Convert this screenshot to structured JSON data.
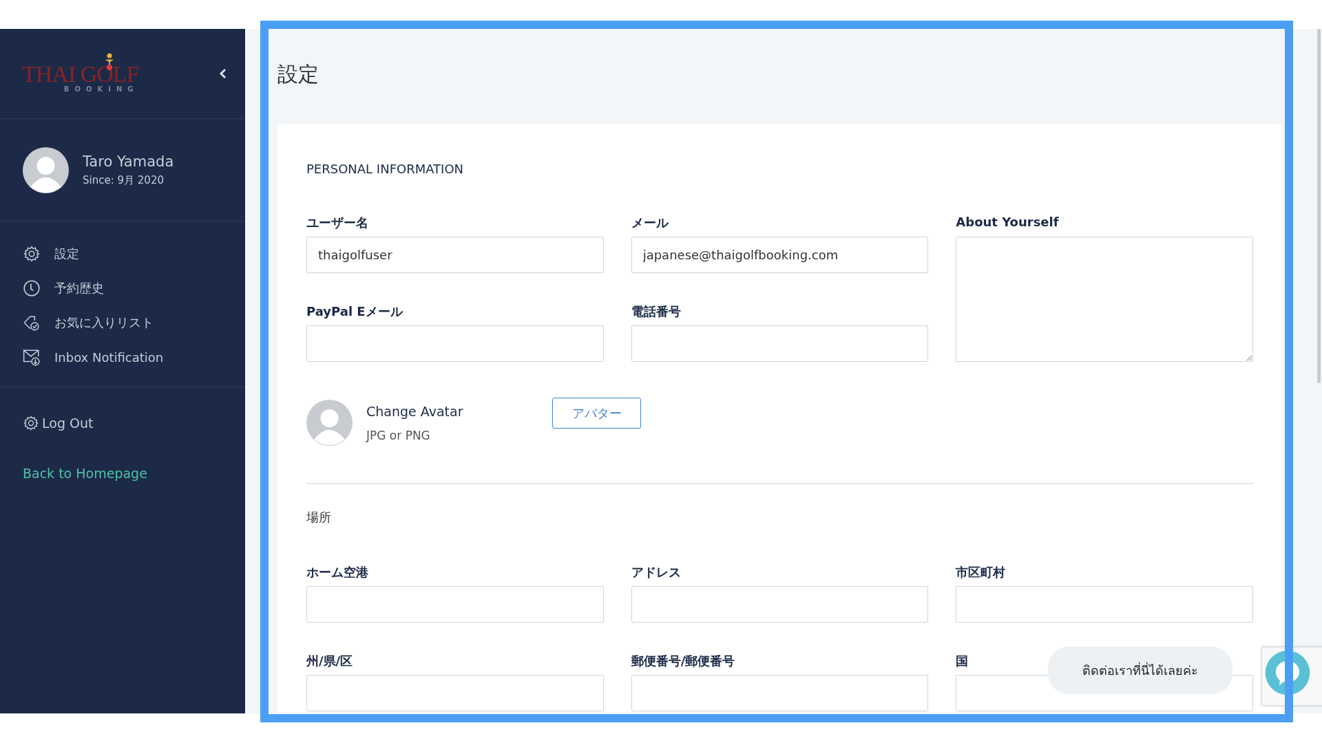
{
  "sidebar": {
    "logo": {
      "title": "THAI GOLF",
      "subtitle": "BOOKING"
    },
    "user": {
      "name": "Taro Yamada",
      "since": "Since: 9月 2020"
    },
    "menu": [
      {
        "label": "設定",
        "kind": "gear"
      },
      {
        "label": "予約歴史",
        "kind": "clock"
      },
      {
        "label": "お気に入りリスト",
        "kind": "tag"
      },
      {
        "label": "Inbox Notification",
        "kind": "mail"
      }
    ],
    "logout": "Log Out",
    "back_link": "Back to Homepage"
  },
  "page_title": "設定",
  "personal": {
    "heading": "PERSONAL INFORMATION",
    "fields": [
      {
        "label": "ユーザー名",
        "kind": "input",
        "value": "thaigolfuser"
      },
      {
        "label": "メール",
        "kind": "input",
        "value": "japanese@thaigolfbooking.com"
      },
      {
        "label": "About Yourself",
        "kind": "textarea"
      },
      {
        "label": "PayPal Eメール",
        "kind": "input"
      },
      {
        "label": "電話番号",
        "kind": "input"
      }
    ],
    "avatar": {
      "title": "Change Avatar",
      "hint": "JPG or PNG",
      "button": "アバター"
    }
  },
  "location": {
    "heading": "場所",
    "fields": [
      {
        "label": "ホーム空港",
        "kind": "input"
      },
      {
        "label": "アドレス",
        "kind": "input"
      },
      {
        "label": "市区町村",
        "kind": "input"
      },
      {
        "label": "州/県/区",
        "kind": "input"
      },
      {
        "label": "郵便番号/郵便番号",
        "kind": "input"
      },
      {
        "label": "国",
        "kind": "input"
      }
    ]
  },
  "chat": {
    "bubble": "ติดต่อเราที่นี่ได้เลยค่ะ"
  }
}
